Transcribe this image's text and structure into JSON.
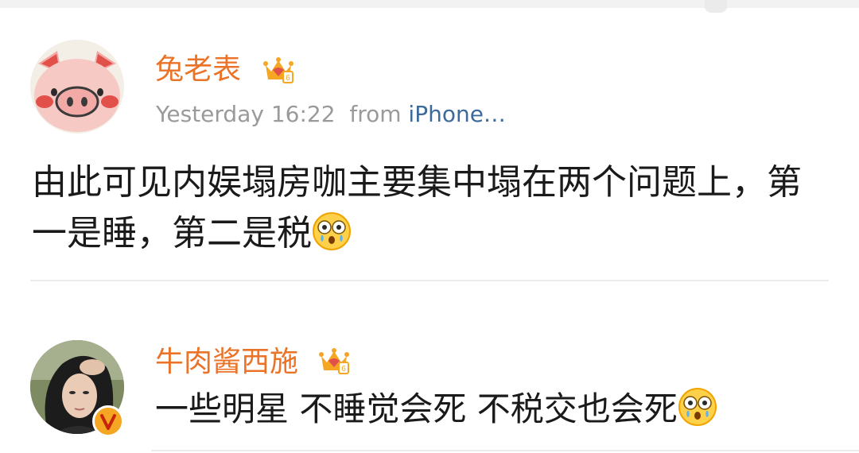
{
  "post": {
    "username": "兔老表",
    "time": "Yesterday 16:22",
    "from_label": "from",
    "source": "iPhone…",
    "text": "由此可见内娱塌房咖主要集中塌在两个问题上，第一是睡，第二是税"
  },
  "reply": {
    "username": "牛肉酱西施",
    "text": "一些明星 不睡觉会死 不税交也会死"
  },
  "colors": {
    "username": "#eb7328",
    "meta": "#9a9a9a",
    "source_link": "#3d6a9a",
    "crown": "#f5a623"
  },
  "icons": {
    "member_badge": "crown-vip-icon",
    "emoji": "dizzy-tears-emoji-icon",
    "verified": "verified-v-icon"
  }
}
